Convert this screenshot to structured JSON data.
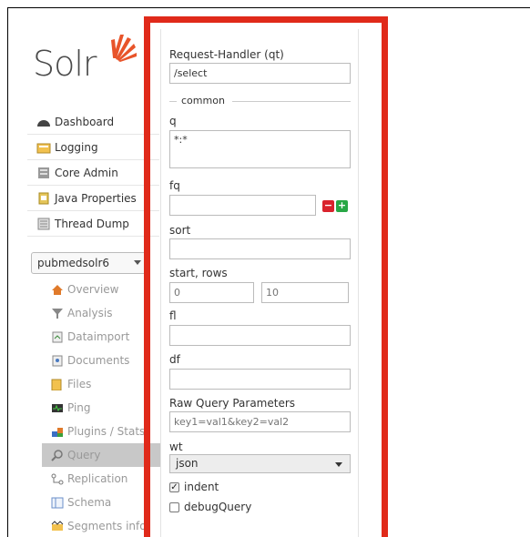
{
  "logo": {
    "text": "Solr"
  },
  "nav": [
    {
      "label": "Dashboard",
      "icon": "dashboard-icon"
    },
    {
      "label": "Logging",
      "icon": "logging-icon"
    },
    {
      "label": "Core Admin",
      "icon": "core-admin-icon"
    },
    {
      "label": "Java Properties",
      "icon": "java-icon"
    },
    {
      "label": "Thread Dump",
      "icon": "thread-dump-icon"
    }
  ],
  "core_selector": {
    "value": "pubmedsolr6"
  },
  "core_nav": [
    {
      "label": "Overview",
      "icon": "home-icon"
    },
    {
      "label": "Analysis",
      "icon": "filter-icon"
    },
    {
      "label": "Dataimport",
      "icon": "dataimport-icon"
    },
    {
      "label": "Documents",
      "icon": "documents-icon"
    },
    {
      "label": "Files",
      "icon": "folder-icon"
    },
    {
      "label": "Ping",
      "icon": "ping-icon"
    },
    {
      "label": "Plugins / Stats",
      "icon": "plugins-icon"
    },
    {
      "label": "Query",
      "icon": "query-icon",
      "active": true
    },
    {
      "label": "Replication",
      "icon": "replication-icon"
    },
    {
      "label": "Schema",
      "icon": "schema-icon"
    },
    {
      "label": "Segments info",
      "icon": "segments-icon"
    }
  ],
  "form": {
    "handler_label": "Request-Handler (qt)",
    "handler_value": "/select",
    "common_legend": "common",
    "q_label": "q",
    "q_value": "*:*",
    "fq_label": "fq",
    "fq_value": "",
    "sort_label": "sort",
    "sort_value": "",
    "start_rows_label": "start, rows",
    "start_placeholder": "0",
    "rows_placeholder": "10",
    "fl_label": "fl",
    "fl_value": "",
    "df_label": "df",
    "df_value": "",
    "raw_label": "Raw Query Parameters",
    "raw_placeholder": "key1=val1&key2=val2",
    "wt_label": "wt",
    "wt_value": "json",
    "indent_label": "indent",
    "indent_checked": true,
    "debug_label": "debugQuery",
    "debug_checked": false
  },
  "colors": {
    "highlight_border": "#e02a1a",
    "remove_button": "#d9232d",
    "add_button": "#28a745"
  }
}
